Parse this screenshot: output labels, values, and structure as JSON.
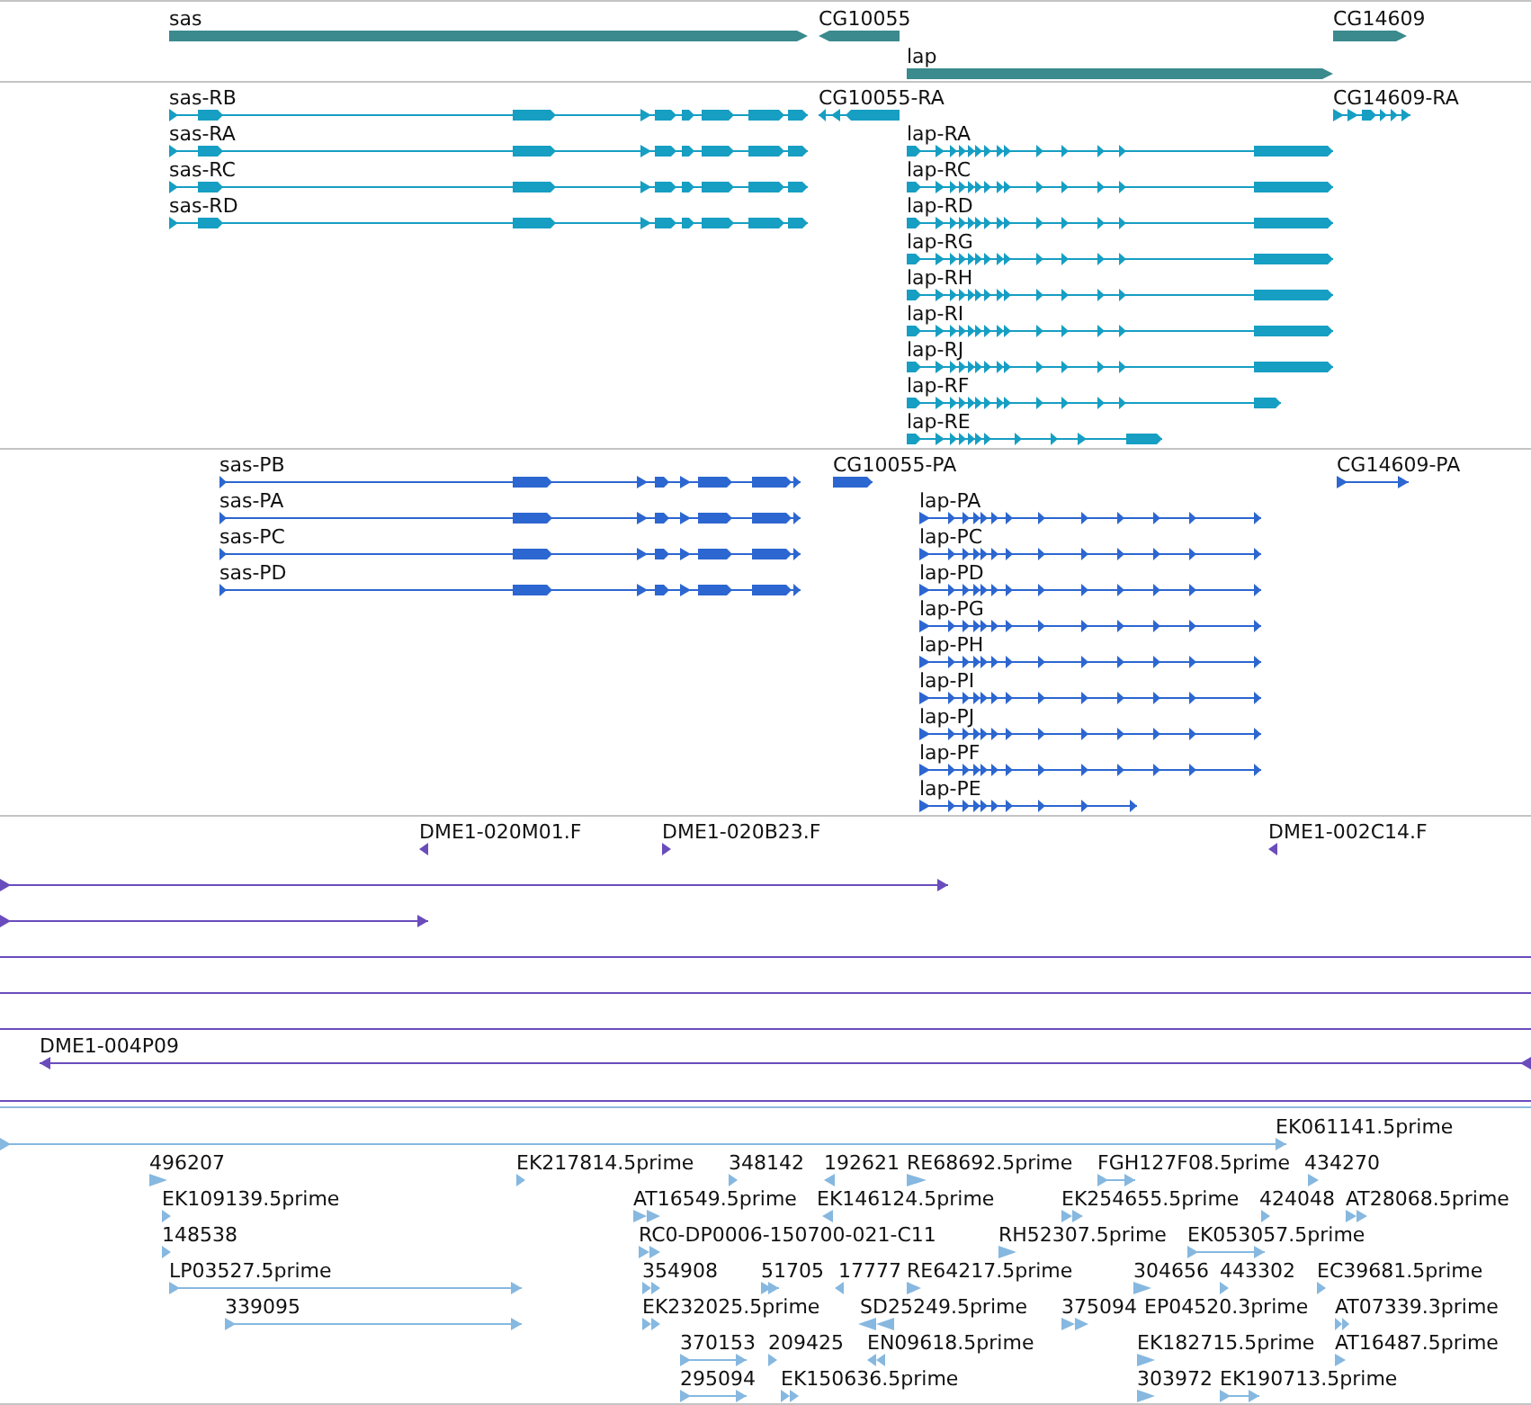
{
  "tracks": [
    {
      "kind": "genes",
      "features": [
        {
          "label": "sas"
        },
        {
          "label": "CG10055"
        },
        {
          "label": "CG14609"
        },
        {
          "label": "lap"
        }
      ]
    },
    {
      "kind": "transcripts",
      "features": [
        {
          "label": "sas-RB"
        },
        {
          "label": "sas-RA"
        },
        {
          "label": "sas-RC"
        },
        {
          "label": "sas-RD"
        },
        {
          "label": "CG10055-RA"
        },
        {
          "label": "CG14609-RA"
        },
        {
          "label": "lap-RA"
        },
        {
          "label": "lap-RC"
        },
        {
          "label": "lap-RD"
        },
        {
          "label": "lap-RG"
        },
        {
          "label": "lap-RH"
        },
        {
          "label": "lap-RI"
        },
        {
          "label": "lap-RJ"
        },
        {
          "label": "lap-RF"
        },
        {
          "label": "lap-RE"
        }
      ]
    },
    {
      "kind": "proteins",
      "features": [
        {
          "label": "sas-PB"
        },
        {
          "label": "sas-PA"
        },
        {
          "label": "sas-PC"
        },
        {
          "label": "sas-PD"
        },
        {
          "label": "CG10055-PA"
        },
        {
          "label": "CG14609-PA"
        },
        {
          "label": "lap-PA"
        },
        {
          "label": "lap-PC"
        },
        {
          "label": "lap-PD"
        },
        {
          "label": "lap-PG"
        },
        {
          "label": "lap-PH"
        },
        {
          "label": "lap-PI"
        },
        {
          "label": "lap-PJ"
        },
        {
          "label": "lap-PF"
        },
        {
          "label": "lap-PE"
        }
      ]
    },
    {
      "kind": "clones",
      "features": [
        {
          "label": "DME1-020M01.F"
        },
        {
          "label": "DME1-020B23.F"
        },
        {
          "label": "DME1-002C14.F"
        },
        {
          "label": "DME1-004P09"
        }
      ]
    },
    {
      "kind": "ests",
      "features": [
        {
          "label": "EK061141.5prime"
        },
        {
          "label": "496207"
        },
        {
          "label": "EK217814.5prime"
        },
        {
          "label": "348142"
        },
        {
          "label": "192621"
        },
        {
          "label": "RE68692.5prime"
        },
        {
          "label": "FGH127F08.5prime"
        },
        {
          "label": "434270"
        },
        {
          "label": "EK109139.5prime"
        },
        {
          "label": "AT16549.5prime"
        },
        {
          "label": "EK146124.5prime"
        },
        {
          "label": "EK254655.5prime"
        },
        {
          "label": "424048"
        },
        {
          "label": "AT28068.5prime"
        },
        {
          "label": "148538"
        },
        {
          "label": "RC0-DP0006-150700-021-C11"
        },
        {
          "label": "RH52307.5prime"
        },
        {
          "label": "EK053057.5prime"
        },
        {
          "label": "LP03527.5prime"
        },
        {
          "label": "354908"
        },
        {
          "label": "51705"
        },
        {
          "label": "17777"
        },
        {
          "label": "RE64217.5prime"
        },
        {
          "label": "304656"
        },
        {
          "label": "443302"
        },
        {
          "label": "EC39681.5prime"
        },
        {
          "label": "339095"
        },
        {
          "label": "EK232025.5prime"
        },
        {
          "label": "SD25249.5prime"
        },
        {
          "label": "375094"
        },
        {
          "label": "EP04520.3prime"
        },
        {
          "label": "AT07339.3prime"
        },
        {
          "label": "370153"
        },
        {
          "label": "209425"
        },
        {
          "label": "EN09618.5prime"
        },
        {
          "label": "EK182715.5prime"
        },
        {
          "label": "AT16487.5prime"
        },
        {
          "label": "295094"
        },
        {
          "label": "EK150636.5prime"
        },
        {
          "label": "303972"
        },
        {
          "label": "EK190713.5prime"
        }
      ]
    }
  ]
}
